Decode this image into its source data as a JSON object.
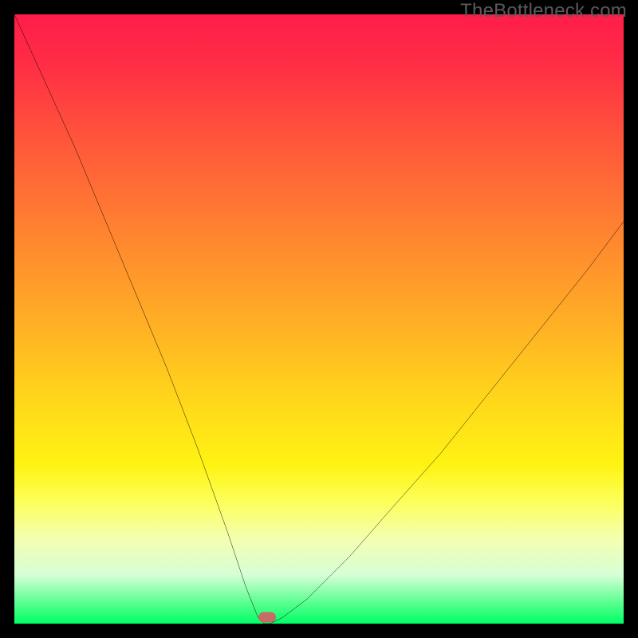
{
  "watermark": "TheBottleneck.com",
  "chart_data": {
    "type": "line",
    "title": "",
    "xlabel": "",
    "ylabel": "",
    "xlim": [
      0,
      100
    ],
    "ylim": [
      0,
      100
    ],
    "grid": false,
    "legend": false,
    "background_gradient": {
      "direction": "top-to-bottom",
      "stops": [
        {
          "pos": 0,
          "color": "#ff1d4a"
        },
        {
          "pos": 22,
          "color": "#ff5a3a"
        },
        {
          "pos": 52,
          "color": "#ffb324"
        },
        {
          "pos": 74,
          "color": "#fff313"
        },
        {
          "pos": 92,
          "color": "#d6ffd6"
        },
        {
          "pos": 100,
          "color": "#00ff66"
        }
      ]
    },
    "series": [
      {
        "name": "bottleneck-curve",
        "color": "#000000",
        "x": [
          0,
          5,
          10,
          15,
          20,
          25,
          30,
          35,
          38,
          40,
          41,
          42,
          44,
          48,
          55,
          62,
          70,
          78,
          86,
          94,
          100
        ],
        "y": [
          100,
          89,
          78,
          66,
          54,
          42,
          29,
          15,
          6,
          1,
          0,
          0,
          1,
          4,
          11,
          19,
          28,
          38,
          48,
          58,
          66
        ]
      }
    ],
    "marker": {
      "x": 41.5,
      "y": 0,
      "color": "#c86a66"
    }
  }
}
